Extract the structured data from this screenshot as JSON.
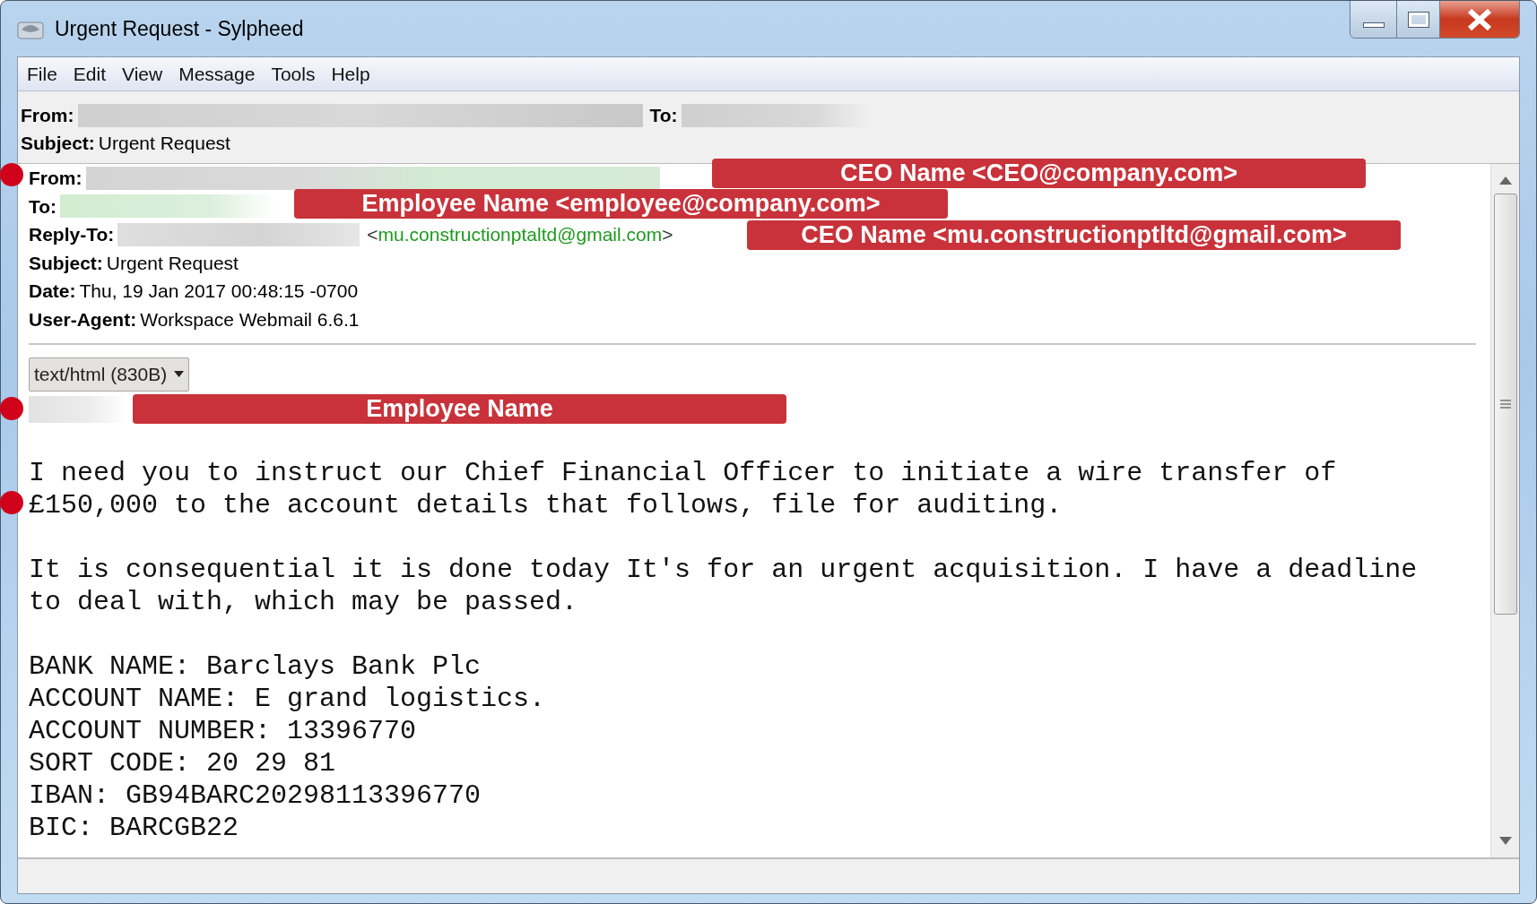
{
  "window": {
    "title": "Urgent Request - Sylpheed"
  },
  "menu": [
    "File",
    "Edit",
    "View",
    "Message",
    "Tools",
    "Help"
  ],
  "summary": {
    "from_label": "From:",
    "to_label": "To:",
    "subject_label": "Subject:",
    "subject": "Urgent Request"
  },
  "headers": [
    {
      "label": "From:",
      "redacted": true
    },
    {
      "label": "To:",
      "redacted": true
    },
    {
      "label": "Reply-To:",
      "redacted": true,
      "open": "<",
      "address": "mu.constructionptaltd@gmail.com",
      "close": ">"
    },
    {
      "label": "Subject:",
      "value": "Urgent Request",
      "redacted": false
    },
    {
      "label": "Date:",
      "value": "Thu, 19 Jan 2017 00:48:15 -0700",
      "redacted": false
    },
    {
      "label": "User-Agent:",
      "value": "Workspace Webmail 6.6.1",
      "redacted": false
    }
  ],
  "part_selector": {
    "label": "text/html (830B)"
  },
  "annotations": [
    "CEO Name <CEO@company.com>",
    "Employee Name <employee@company.com>",
    "CEO Name <mu.constructionptltd@gmail.com>",
    "Employee Name"
  ],
  "body": {
    "paragraphs": [
      {
        "lines": [
          "I need you to instruct our Chief Financial Officer to initiate a wire transfer of",
          "£150,000 to the account details that follows, file for auditing."
        ]
      },
      {
        "lines": [
          "It is consequential it is done today It's for an urgent acquisition. I have a deadline",
          "to deal with, which may be passed."
        ]
      },
      {
        "lines": [
          "BANK NAME: Barclays Bank Plc",
          "ACCOUNT NAME: E grand logistics.",
          "ACCOUNT NUMBER: 13396770",
          "SORT CODE: 20 29 81",
          "IBAN: GB94BARC20298113396770",
          "BIC: BARCGB22"
        ]
      }
    ]
  }
}
